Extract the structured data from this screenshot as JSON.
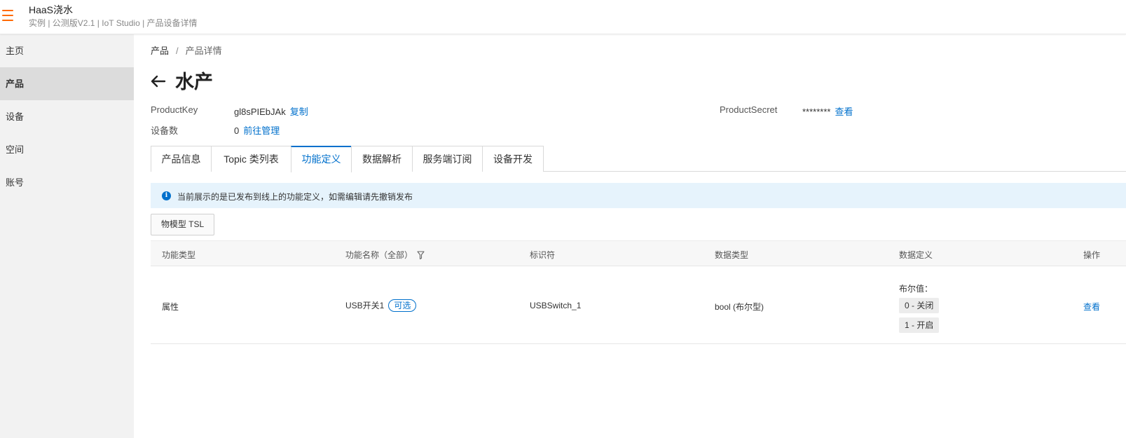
{
  "header": {
    "title": "HaaS浇水",
    "subtitle": "实例 | 公测版V2.1 | IoT Studio | 产品设备详情"
  },
  "sidebar": {
    "items": [
      {
        "label": "主页"
      },
      {
        "label": "产品"
      },
      {
        "label": "设备"
      },
      {
        "label": "空间"
      },
      {
        "label": "账号"
      }
    ],
    "active": "产品"
  },
  "breadcrumb": {
    "root": "产品",
    "separator": "/",
    "current": "产品详情"
  },
  "product": {
    "name": "水产",
    "key_label": "ProductKey",
    "key_value": "gl8sPIEbJAk",
    "copy_link": "复制",
    "secret_label": "ProductSecret",
    "secret_value": "********",
    "view_link": "查看",
    "device_count_label": "设备数",
    "device_count": "0",
    "manage_link": "前往管理"
  },
  "tabs": [
    {
      "label": "产品信息"
    },
    {
      "label": "Topic 类列表"
    },
    {
      "label": "功能定义"
    },
    {
      "label": "数据解析"
    },
    {
      "label": "服务端订阅"
    },
    {
      "label": "设备开发"
    }
  ],
  "active_tab": "功能定义",
  "notice": {
    "text": "当前展示的是已发布到线上的功能定义，如需编辑请先撤销发布"
  },
  "tsl_button": "物模型 TSL",
  "table": {
    "columns": [
      "功能类型",
      "功能名称（全部）",
      "标识符",
      "数据类型",
      "数据定义",
      "操作"
    ],
    "rows": [
      {
        "type": "属性",
        "name": "USB开关1",
        "tag": "可选",
        "identifier": "USBSwitch_1",
        "data_type": "bool (布尔型)",
        "definition_title": "布尔值：",
        "definition_values": [
          "0 - 关闭",
          "1 - 开启"
        ],
        "action": "查看"
      }
    ]
  },
  "colors": {
    "accent": "#0070cc",
    "menu_icon": "#ff6a00",
    "notice_bg": "#e6f3fc"
  }
}
